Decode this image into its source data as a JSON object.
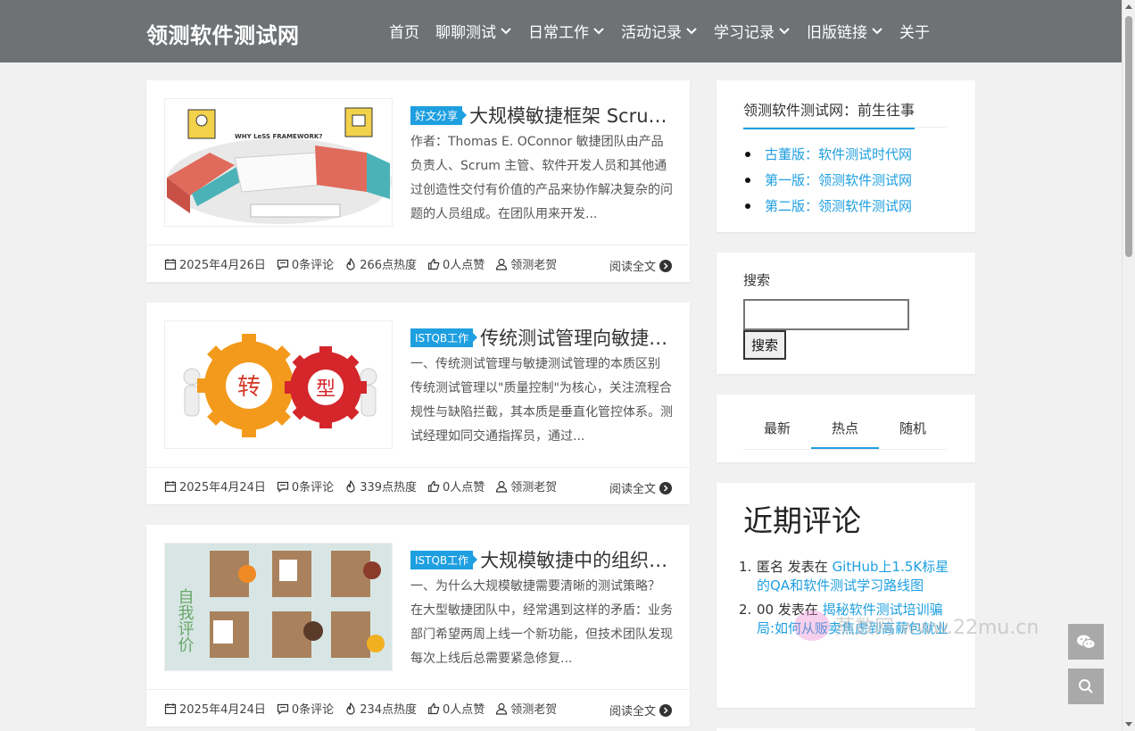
{
  "site": {
    "logo": "领测软件测试网",
    "nav": [
      {
        "label": "首页",
        "has_dropdown": false
      },
      {
        "label": "聊聊测试",
        "has_dropdown": true
      },
      {
        "label": "日常工作",
        "has_dropdown": true
      },
      {
        "label": "活动记录",
        "has_dropdown": true
      },
      {
        "label": "学习记录",
        "has_dropdown": true
      },
      {
        "label": "旧版链接",
        "has_dropdown": true
      },
      {
        "label": "关于",
        "has_dropdown": false
      }
    ]
  },
  "posts": [
    {
      "category": "好文分享",
      "title": "大规模敏捷框架 Scrum@Scale 的 LeSS 框架",
      "excerpt": "作者：Thomas E. OConnor 敏捷团队由产品负责人、Scrum 主管、软件开发人员和其他通过创造性交付有价值的产品来协作解决复杂的问题的人员组成。在团队用来开发...",
      "date": "2025年4月26日",
      "comments": "0条评论",
      "views": "266点热度",
      "likes": "0人点赞",
      "author": "领测老贺",
      "read_more": "阅读全文",
      "thumb_text": {
        "heading": "WHY LeSS FRAMEWORK?"
      }
    },
    {
      "category": "ISTQB工作",
      "title": "传统测试管理向敏捷测试管理的转型",
      "excerpt": "一、传统测试管理与敏捷测试管理的本质区别 传统测试管理以\"质量控制\"为核心，关注流程合规性与缺陷拦截，其本质是垂直化管控体系。测试经理如同交通指挥员，通过...",
      "date": "2025年4月24日",
      "comments": "0条评论",
      "views": "339点热度",
      "likes": "0人点赞",
      "author": "领测老贺",
      "read_more": "阅读全文",
      "thumb_text": {
        "left": "转",
        "right": "型"
      }
    },
    {
      "category": "ISTQB工作",
      "title": "大规模敏捷中的组织级测试策略",
      "excerpt": "一、为什么大规模敏捷需要清晰的测试策略？ 在大型敏捷团队中，经常遇到这样的矛盾：业务部门希望两周上线一个新功能，但技术团队发现每次上线后总需要紧急修复...",
      "date": "2025年4月24日",
      "comments": "0条评论",
      "views": "234点热度",
      "likes": "0人点赞",
      "author": "领测老贺",
      "read_more": "阅读全文",
      "thumb_text": {
        "side": "自我评价"
      }
    }
  ],
  "sidebar": {
    "history": {
      "title": "领测软件测试网：前生往事",
      "links": [
        "古董版：软件测试时代网",
        "第一版：领测软件测试网",
        "第二版：领测软件测试网"
      ]
    },
    "search": {
      "title": "搜索",
      "button": "搜索",
      "value": ""
    },
    "tabs": [
      "最新",
      "热点",
      "随机"
    ],
    "active_tab": "热点",
    "recent_comments": {
      "title": "近期评论",
      "items": [
        {
          "num": "1.",
          "author": "匿名",
          "mid": " 发表在 ",
          "link": "GitHub上1.5K标星的QA和软件测试学习路线图"
        },
        {
          "num": "2.",
          "author": "00",
          "mid": " 发表在 ",
          "link": "揭秘软件测试培训骗局:如何从贩卖焦虑到高薪包就业"
        }
      ]
    }
  },
  "watermark": "蒸数网 www.22mu.cn",
  "colors": {
    "header": "#6e7275",
    "accent": "#1e9fe0",
    "background": "#f1f1f1"
  }
}
